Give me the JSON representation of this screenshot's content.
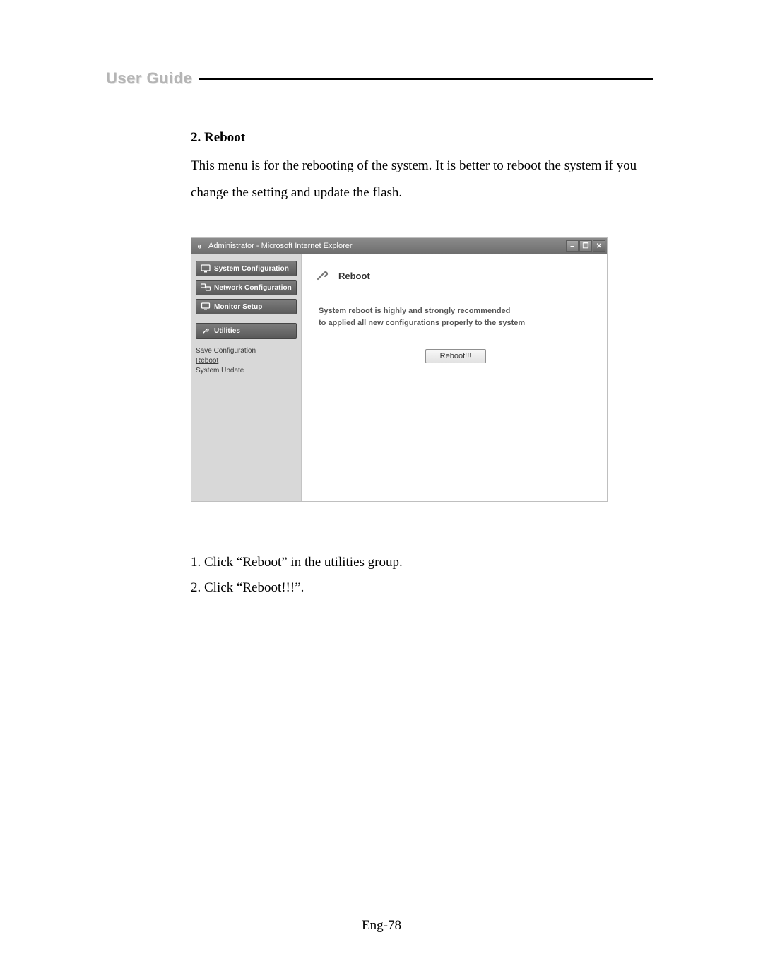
{
  "brand": "User Guide",
  "section_title": "2. Reboot",
  "paragraph": "This menu is for the rebooting of the system. It is better to reboot the system if you change the setting and update the flash.",
  "screenshot": {
    "window_title": "Administrator - Microsoft Internet Explorer",
    "sidebar": {
      "items": [
        {
          "label": "System Configuration"
        },
        {
          "label": "Network Configuration"
        },
        {
          "label": "Monitor Setup"
        },
        {
          "label": "Utilities"
        }
      ],
      "subitems": [
        {
          "label": "Save Configuration"
        },
        {
          "label": "Reboot"
        },
        {
          "label": "System Update"
        }
      ]
    },
    "panel": {
      "title": "Reboot",
      "line1": "System reboot is highly and strongly recommended",
      "line2": "to applied all new configurations properly to the system",
      "button": "Reboot!!!"
    }
  },
  "steps": [
    "1. Click “Reboot” in the utilities group.",
    "2. Click “Reboot!!!”."
  ],
  "page_number": "Eng-78"
}
